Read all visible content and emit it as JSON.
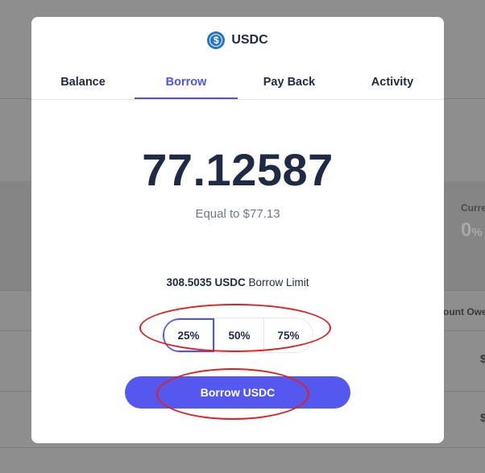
{
  "background": {
    "current_label": "Curre",
    "current_value": "0",
    "current_unit": "%",
    "amount_owed_label": "ount Owe",
    "row1_value": "$",
    "row2_value": "$"
  },
  "modal": {
    "asset": {
      "icon": "usdc-coin-icon",
      "name": "USDC"
    },
    "tabs": [
      {
        "label": "Balance"
      },
      {
        "label": "Borrow"
      },
      {
        "label": "Pay Back"
      },
      {
        "label": "Activity"
      }
    ],
    "active_tab": "Borrow",
    "amount": "77.12587",
    "equal_to": "Equal to $77.13",
    "limit": {
      "value": "308.5035 USDC",
      "label": "Borrow Limit"
    },
    "percent_options": [
      "25%",
      "50%",
      "75%"
    ],
    "selected_percent": "25%",
    "borrow_button_label": "Borrow USDC",
    "colors": {
      "accent": "#4f54e8",
      "button": "#5458ef",
      "text": "#1f2a44",
      "coin": "#2775ca",
      "annotation": "#e0211f"
    }
  }
}
